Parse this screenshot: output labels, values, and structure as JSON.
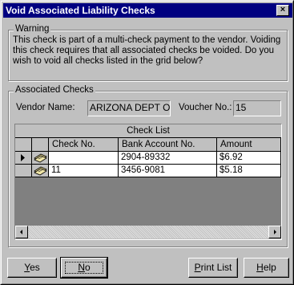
{
  "window": {
    "title": "Void Associated Liability Checks",
    "close_glyph": "×"
  },
  "warning": {
    "group_label": "Warning",
    "text": "This check is part of a multi-check payment to the vendor.  Voiding this check requires that all associated checks be voided.  Do you wish to void all checks listed in the grid below?"
  },
  "associated": {
    "group_label": "Associated Checks",
    "vendor_label": "Vendor Name:",
    "vendor_value": "ARIZONA DEPT OF",
    "voucher_label": "Voucher No.:",
    "voucher_value": "15"
  },
  "grid": {
    "caption": "Check List",
    "columns": [
      "Check No.",
      "Bank Account No.",
      "Amount"
    ],
    "rows": [
      {
        "check_no": "",
        "bank_account": "2904-89332",
        "amount": "$6.92",
        "current": true
      },
      {
        "check_no": "11",
        "bank_account": "3456-9081",
        "amount": "$5.18",
        "current": false
      }
    ]
  },
  "buttons": {
    "yes": {
      "label_rest": "es",
      "mnemonic": "Y"
    },
    "no": {
      "label_rest": "o",
      "mnemonic": "N"
    },
    "print": {
      "label_rest": "rint List",
      "mnemonic": "P"
    },
    "help": {
      "label_rest": "elp",
      "mnemonic": "H"
    }
  }
}
